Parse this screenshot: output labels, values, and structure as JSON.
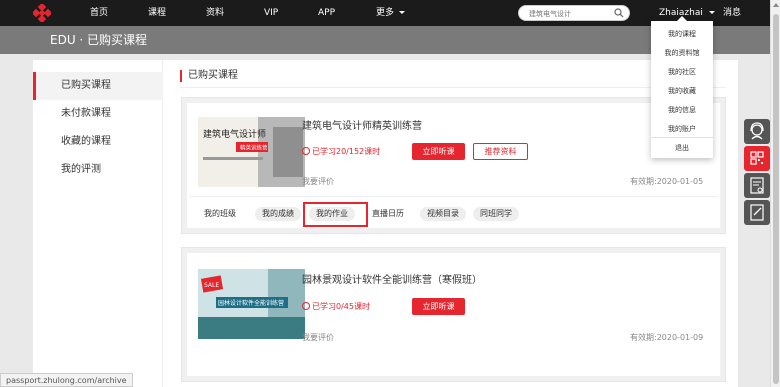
{
  "nav": {
    "items": [
      "首页",
      "课程",
      "资料",
      "VIP",
      "APP",
      "更多"
    ],
    "search_placeholder": "建筑电气设计",
    "username": "Zhaiazhai",
    "messages": "消息"
  },
  "header": {
    "title": "EDU · 已购买课程"
  },
  "sidebar": {
    "items": [
      "已购买课程",
      "未付款课程",
      "收藏的课程",
      "我的评测"
    ]
  },
  "main": {
    "title": "已购买课程"
  },
  "courses": [
    {
      "thumb_text": "建筑电气设计师",
      "thumb_sub": "精英训练营",
      "title": "建筑电气设计师精英训练营",
      "progress": "已学习20/152课时",
      "listen_label": "立即听课",
      "recommend_label": "推荐资料",
      "eval_label": "我要评价",
      "expire": "有效期:2020-01-05",
      "tabs": [
        "我的班级",
        "我的成绩",
        "我的作业",
        "直播日历",
        "视频目录",
        "同班同学"
      ]
    },
    {
      "thumb_text": "园林设计软件全能训练营",
      "thumb_sale": "SALE",
      "title": "园林景观设计软件全能训练营（寒假班）",
      "progress": "已学习0/45课时",
      "listen_label": "立即听课",
      "eval_label": "我要评价",
      "expire": "有效期:2020-01-09"
    }
  ],
  "dropdown": {
    "items": [
      "我的课程",
      "我的资料馆",
      "我的社区",
      "我的收藏",
      "我的信息",
      "我的账户"
    ],
    "logout": "退出"
  },
  "status_url": "passport.zhulong.com/archive",
  "colors": {
    "accent": "#e5262f",
    "topbar": "#1b1b1b",
    "header_band": "#7a7a7a"
  },
  "icons": {
    "float": [
      "customer-service-icon",
      "qr-code-icon",
      "certificate-icon",
      "edit-note-icon"
    ]
  }
}
